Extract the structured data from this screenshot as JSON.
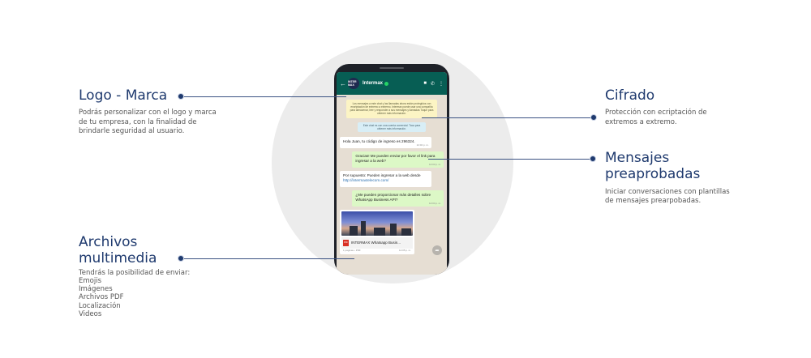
{
  "phone": {
    "contact_name": "Intermax",
    "avatar_text": "INTER MAX",
    "system_notice": "Los mensajes a este chat y las llamadas ahora están protegidos con encriptación de extremo a extremo. Intermax puede usar una compañía para almacenar, leer y responder a sus mensajes y llamadas Toque para obtener más información.",
    "business_notice": "Este chat es con una cuenta comercial. Toca para obtener más información.",
    "messages": [
      {
        "text": "Hola Juan, tu código de ingreso es 296324.",
        "time": "12:02 p. m."
      },
      {
        "text": "Gracias! Me pueden enviar por favor el link para ingresar a la web?",
        "time": "12:03 p. m."
      },
      {
        "text_pre": "Por supuesto: Pueden ingresar a la web desde ",
        "link": "http://intermaxtelecom.com/",
        "time": ""
      },
      {
        "text": "¿Me pueden proporcionar más detalles sobre WhatsApp Business API?",
        "time": "12:04 p. m."
      }
    ],
    "document": {
      "name": "INTERMAX Whatsapp Busin...",
      "meta_left": "1 páginas • PDF",
      "meta_right": "12:05 p. m.",
      "type": "PDF"
    }
  },
  "annotations": {
    "logo": {
      "title": "Logo - Marca",
      "desc": "Podrás personalizar con el logo y marca de tu empresa, con la finalidad de brindarle seguridad al usuario."
    },
    "cifrado": {
      "title": "Cifrado",
      "desc": "Protección con ecriptación de extremos a extremo."
    },
    "mensajes": {
      "title": "Mensajes preaprobadas",
      "desc": "Iniciar conversaciones con plantillas de mensajes prearpobadas."
    },
    "archivos": {
      "title": "Archivos multimedia",
      "desc_intro": "Tendrás la posibilidad de enviar:",
      "items": [
        "Emojis",
        "Imágenes",
        "Archivos PDF",
        "Localización",
        "Videos"
      ]
    }
  },
  "colors": {
    "accent": "#1f3a6e",
    "wa_header": "#075e54",
    "bubble_out": "#dcf8c6"
  }
}
